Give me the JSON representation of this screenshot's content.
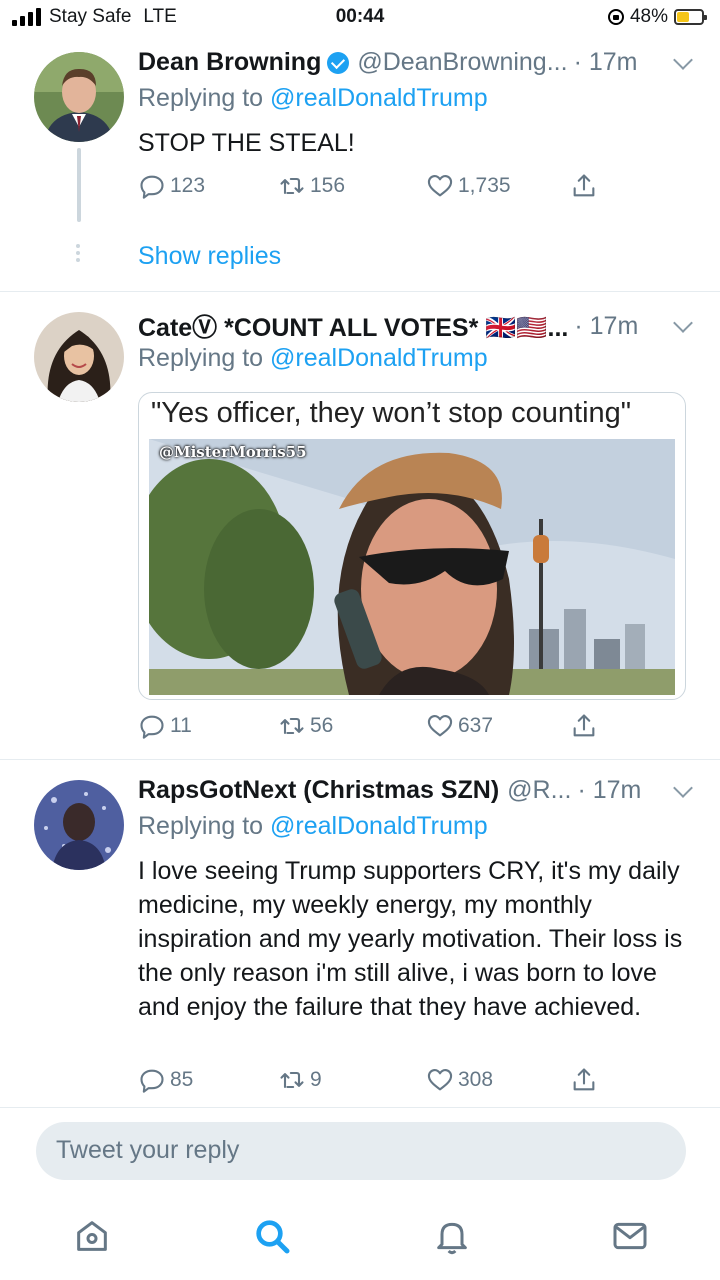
{
  "status_bar": {
    "carrier": "Stay Safe",
    "network": "LTE",
    "time": "00:44",
    "battery": "48%",
    "battery_level": 0.48
  },
  "tweets": [
    {
      "name": "Dean Browning",
      "verified": true,
      "handle": "@DeanBrowning...",
      "time": "· 17m",
      "replying_prefix": "Replying to",
      "replying_to": "@realDonaldTrump",
      "text": "STOP THE STEAL!",
      "replies": "123",
      "retweets": "156",
      "likes": "1,735",
      "show_replies": "Show replies"
    },
    {
      "name": "CateⓋ *COUNT ALL VOTES* 🇬🇧🇺🇸...",
      "handle": "",
      "time": "· 17m",
      "replying_prefix": "Replying to",
      "replying_to": "@realDonaldTrump",
      "media_caption": "\"Yes officer, they won’t stop counting\"",
      "media_watermark": "@MisterMorris55",
      "replies": "11",
      "retweets": "56",
      "likes": "637"
    },
    {
      "name": "RapsGotNext (Christmas SZN)",
      "handle": "@R...",
      "time": "· 17m",
      "replying_prefix": "Replying to",
      "replying_to": "@realDonaldTrump",
      "text": "I love seeing Trump supporters CRY, it's my daily medicine, my weekly energy, my monthly inspiration and my yearly motivation. Their loss is the only reason i'm still alive, i was born to love and enjoy the failure that they have achieved.",
      "replies": "85",
      "retweets": "9",
      "likes": "308"
    }
  ],
  "reply_box": {
    "placeholder": "Tweet your reply"
  },
  "tab_bar": {
    "tabs": [
      "home-icon",
      "search-icon",
      "notifications-icon",
      "messages-icon"
    ],
    "active_color": "#1da1f2",
    "inactive_color": "#657786"
  },
  "colors": {
    "link": "#1da1f2",
    "muted": "#657786",
    "divider": "#e6ecf0",
    "battery": "#f5c518"
  }
}
